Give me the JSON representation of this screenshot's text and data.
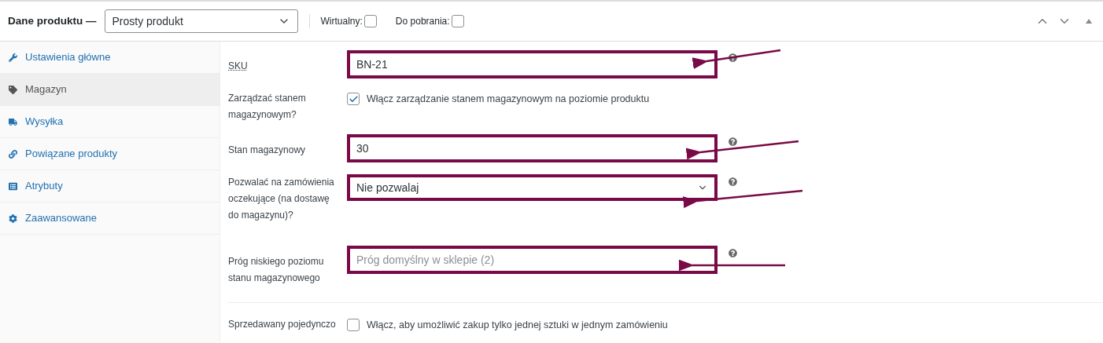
{
  "header": {
    "title": "Dane produktu —",
    "product_type": "Prosty produkt",
    "options": [
      {
        "label": "Wirtualny:",
        "checked": false
      },
      {
        "label": "Do pobrania:",
        "checked": false
      }
    ]
  },
  "tabs": [
    {
      "label": "Ustawienia główne",
      "selected": false
    },
    {
      "label": "Magazyn",
      "selected": true
    },
    {
      "label": "Wysyłka",
      "selected": false
    },
    {
      "label": "Powiązane produkty",
      "selected": false
    },
    {
      "label": "Atrybuty",
      "selected": false
    },
    {
      "label": "Zaawansowane",
      "selected": false
    }
  ],
  "fields": [
    {
      "kind": "text",
      "label": "SKU",
      "value": "BN-21",
      "highlighted": true
    },
    {
      "kind": "checkbox",
      "label": "Zarządzać stanem magazynowym?",
      "text": "Włącz zarządzanie stanem magazynowym na poziomie produktu",
      "checked": true
    },
    {
      "kind": "text",
      "label": "Stan magazynowy",
      "value": "30",
      "highlighted": true
    },
    {
      "kind": "select",
      "label": "Pozwalać na zamówienia oczekujące (na dostawę do magazynu)?",
      "value": "Nie pozwalaj",
      "highlighted": true
    },
    {
      "kind": "placeholder",
      "label": "Próg niskiego poziomu stanu magazynowego",
      "placeholder": "Próg domyślny w sklepie (2)",
      "highlighted": true
    },
    {
      "kind": "checkbox",
      "label": "Sprzedawany pojedynczo",
      "text": "Włącz, aby umożliwić zakup tylko jednej sztuki w jednym zamówieniu",
      "checked": false
    }
  ]
}
